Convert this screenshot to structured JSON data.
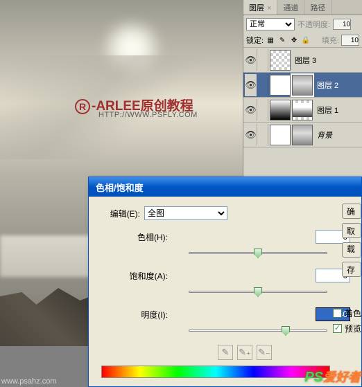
{
  "watermark": {
    "logo_text": "-ARLEE原创教程",
    "r_symbol": "R",
    "url": "HTTP://WWW.PSFLY.COM"
  },
  "layers_panel": {
    "tabs": {
      "layers": "图层",
      "channels": "通道",
      "paths": "路径"
    },
    "blend_mode": "正常",
    "opacity_label": "不透明度:",
    "opacity_value": "10",
    "lock_label": "锁定:",
    "fill_label": "填充:",
    "fill_value": "10",
    "layers": [
      {
        "name": "图层 3"
      },
      {
        "name": "图层 2"
      },
      {
        "name": "图层 1"
      },
      {
        "name": "背景"
      }
    ]
  },
  "dialog": {
    "title": "色相/饱和度",
    "edit_label": "编辑(E):",
    "edit_value": "全图",
    "hue_label": "色相(H):",
    "hue_value": "0",
    "sat_label": "饱和度(A):",
    "sat_value": "0",
    "light_label": "明度(I):",
    "light_value": "+40",
    "colorize_label": "着色",
    "preview_label": "预览",
    "btn_ok": "确",
    "btn_cancel": "取",
    "btn_load": "载入",
    "btn_save": "存"
  },
  "bottom_watermark": {
    "left": "www.psahz.com",
    "ps": "PS",
    "ahz": "爱好者"
  }
}
